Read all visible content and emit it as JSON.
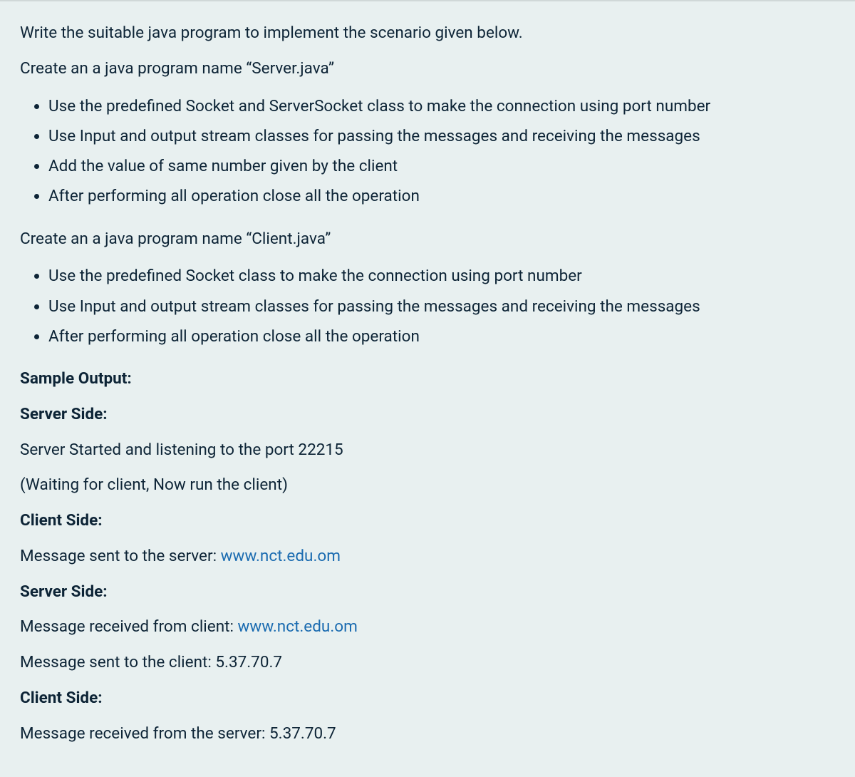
{
  "intro": "Write the suitable java program to implement the scenario given below.",
  "server_create": "Create an a java program name “Server.java”",
  "server_bullets": [
    "Use the predefined Socket and ServerSocket class to make the connection using port number",
    "Use Input and output stream classes for passing the messages and receiving the messages",
    "Add the value of same number given by the client",
    "After performing all operation close all the operation"
  ],
  "client_create": "Create an a java program name “Client.java”",
  "client_bullets": [
    "Use the predefined Socket class to make the connection using port number",
    "Use Input and output stream classes for passing the messages and receiving the messages",
    "After performing all operation close all the operation"
  ],
  "sample_output_heading": "Sample Output:",
  "server_side_heading": "Server Side:",
  "client_side_heading": "Client Side:",
  "server_started": "Server Started and listening to the port 22215",
  "waiting_text": "(Waiting for client, Now run the client)",
  "client_msg_sent_prefix": "Message sent to the server: ",
  "link_url": "www.nct.edu.om",
  "server_msg_received_prefix": "Message received from client: ",
  "server_msg_sent": "Message sent to the client: 5.37.70.7",
  "client_msg_received": "Message received from the server: 5.37.70.7"
}
